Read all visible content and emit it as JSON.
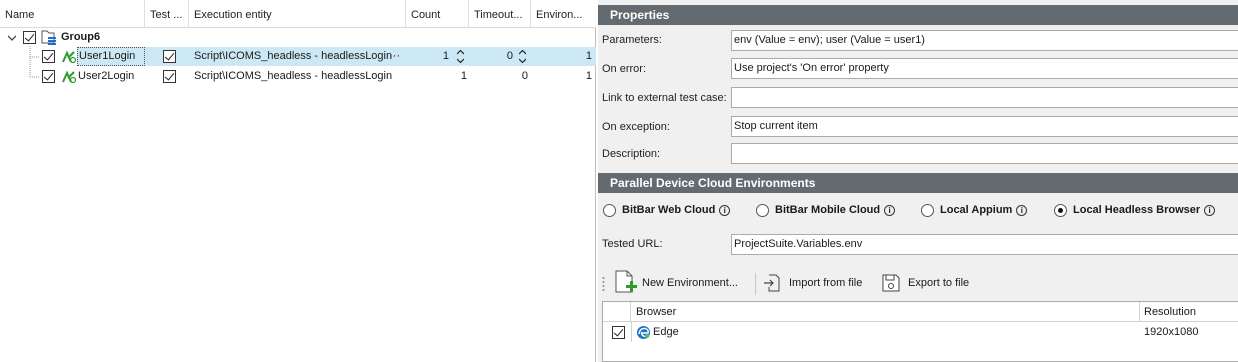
{
  "tree": {
    "columns": [
      "Name",
      "Test ...",
      "Execution entity",
      "Count",
      "Timeout...",
      "Environ..."
    ],
    "group": {
      "name": "Group6"
    },
    "rows": [
      {
        "name": "User1Login",
        "entity": "Script\\ICOMS_headless - headlessLogin",
        "entity_more": "···",
        "count": "1",
        "timeout": "0",
        "env": "1"
      },
      {
        "name": "User2Login",
        "entity": "Script\\ICOMS_headless - headlessLogin",
        "count": "1",
        "timeout": "0",
        "env": "1"
      }
    ]
  },
  "properties": {
    "title": "Properties",
    "fields": [
      {
        "label": "Parameters:",
        "value": "env (Value = env); user (Value = user1)"
      },
      {
        "label": "On error:",
        "value": "Use project's 'On error' property"
      },
      {
        "label": "Link to external test case:",
        "value": ""
      },
      {
        "label": "On exception:",
        "value": "Stop current item"
      },
      {
        "label": "Description:",
        "value": ""
      }
    ]
  },
  "environments": {
    "title": "Parallel Device Cloud Environments",
    "options": [
      {
        "label": "BitBar Web Cloud",
        "selected": false
      },
      {
        "label": "BitBar Mobile Cloud",
        "selected": false
      },
      {
        "label": "Local Appium",
        "selected": false
      },
      {
        "label": "Local Headless Browser",
        "selected": true
      }
    ],
    "info_glyph": "i",
    "tested_url_label": "Tested URL:",
    "tested_url_value": "ProjectSuite.Variables.env",
    "toolbar": {
      "new_env": "New Environment...",
      "import": "Import from file",
      "export": "Export to file"
    },
    "grid": {
      "columns": [
        "Browser",
        "Resolution"
      ],
      "rows": [
        {
          "browser": "Edge",
          "resolution": "1920x1080"
        }
      ]
    }
  },
  "colors": {
    "section_header": "#636b70",
    "selected_row": "#cce8f4",
    "add_green": "#2e9b2e",
    "edge_blue": "#1b74c6"
  }
}
